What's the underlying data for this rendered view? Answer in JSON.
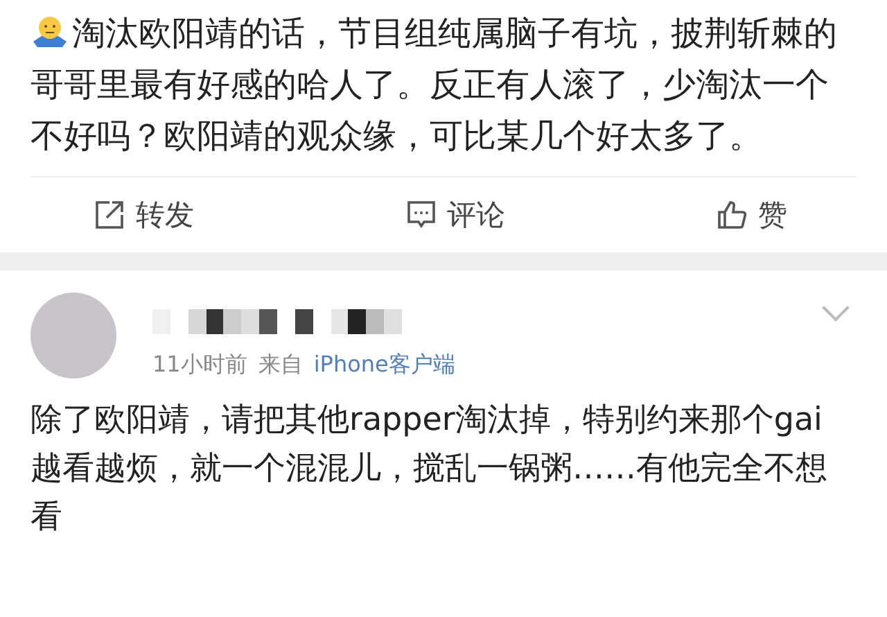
{
  "post": {
    "text": "淘汰欧阳靖的话，节目组纯属脑子有坑，披荆斩棘的哥哥里最有好感的哈人了。反正有人滚了，少淘汰一个不好吗？欧阳靖的观众缘，可比某几个好太多了。",
    "actions": [
      {
        "kind": "repost",
        "label": "转发"
      },
      {
        "kind": "comment",
        "label": "评论"
      },
      {
        "kind": "like",
        "label": "赞"
      }
    ]
  },
  "comment": {
    "time": "11小时前",
    "source_prefix": "来自",
    "source": "iPhone客户端",
    "text": "除了欧阳靖，请把其他rapper淘汰掉，特别约来那个gai越看越烦，就一个混混儿，搅乱一锅粥……有他完全不想看"
  }
}
